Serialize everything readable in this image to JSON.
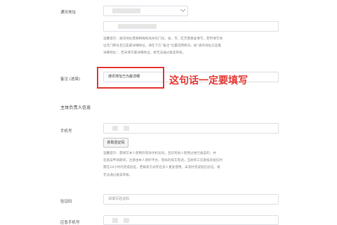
{
  "form": {
    "address_label": "通讯地址",
    "address_hint": [
      "温馨提示：通讯地址需要精确到具体的门号，省、市、区无需重复填写，若所填写地",
      "址无门牌号且已是最详细地址，请在下方“备注”位置说明情况，如“通讯地址已是最",
      "详细地址”，若未填写最详细地址，将无法通过备案审核。"
    ],
    "remark_label": "备注 (选填)",
    "remark_value": "通讯地址已为最详细",
    "annotation": "这句话一定要填写",
    "section_title": "主体负责人信息",
    "phone_label": "手机号",
    "get_code_button": "获取验证码",
    "phone_hint": [
      "温馨提示：需填写本人使用的有效手机号码，且仅有他人使用过进行备案的；并",
      "在备案申请期间，注意由本人接听平台、管局的核实电话，当收到工信部核验短信时",
      "需在24小时内完成验证，若联系方式存在多人重复使用，未及时完成短信验证，将",
      "无法通过备案审核。"
    ],
    "code_label": "验证码",
    "code_placeholder": "请填写验证码",
    "emergency_label": "应急手机号"
  },
  "colors": {
    "accent": "#e53935",
    "border": "#dcdfe6"
  }
}
